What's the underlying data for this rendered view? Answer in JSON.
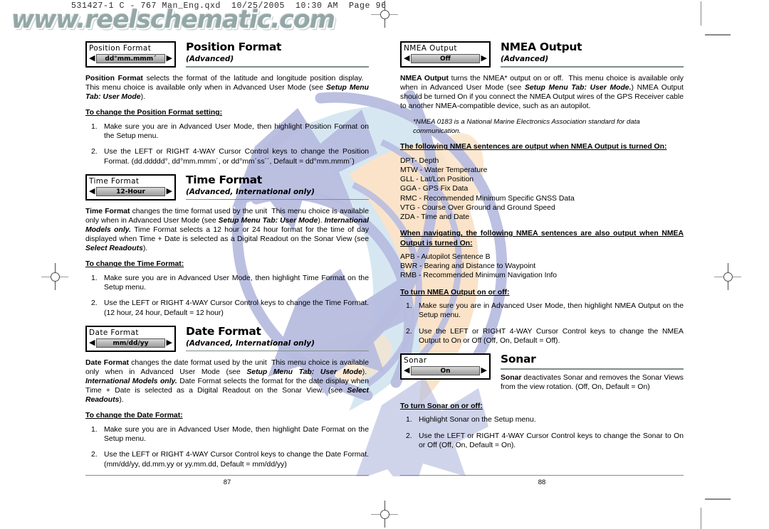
{
  "prepress": {
    "slug": "531427-1 C - 767 Man_Eng.qxd  10/25/2005  10:30 AM  Page 96",
    "watermark": "www.reelschematic.com"
  },
  "left_page": {
    "page_number": "87",
    "sections": [
      {
        "widget": {
          "label": "Position Format",
          "value": "dd°mm.mmm´",
          "left_arrow": "◀",
          "right_arrow": "▶"
        },
        "title": "Position Format",
        "subtitle": "(Advanced)",
        "intro_html": "<b>Position Format</b> selects the format of the latitude and longitude position display.&nbsp;&nbsp; This menu choice is available only when in Advanced User Mode (see <span class=\"bi\">Setup Menu Tab: User Mode</span>).",
        "sub_head": "To change the Position Format setting:",
        "steps": [
          "Make sure you are in Advanced User Mode, then highlight Position Format on the Setup menu.",
          "Use the LEFT or RIGHT 4-WAY Cursor Control keys to change the Position Format. (dd.ddddd°, dd°mm.mmm´, or dd°mm´ss´´, Default = dd°mm.mmm´)"
        ]
      },
      {
        "widget": {
          "label": "Time Format",
          "value": "12-Hour",
          "left_arrow": "◀",
          "right_arrow": "▶"
        },
        "title": "Time Format",
        "subtitle": "(Advanced, International only)",
        "intro_html": "<b>Time Format</b> changes the time format used by the unit&nbsp; This menu choice is available only when in Advanced User Mode (see <span class=\"bi\">Setup Menu Tab: User Mode</span>). <span class=\"bi\">International Models only.</span> Time Format selects a 12 hour or 24 hour format for the time of day displayed when Time + Date is selected as a Digital Readout on the Sonar View (see <span class=\"bi\">Select Readouts</span>).",
        "sub_head": "To change the Time Format:",
        "steps": [
          "Make sure you are in Advanced User Mode, then highlight Time Format on the Setup menu.",
          "Use the LEFT or RIGHT 4-WAY Cursor Control keys to change the Time Format. (12 hour, 24 hour, Default = 12 hour)"
        ]
      },
      {
        "widget": {
          "label": "Date Format",
          "value": "mm/dd/yy",
          "left_arrow": "◀",
          "right_arrow": "▶"
        },
        "title": "Date Format",
        "subtitle": "(Advanced, International only)",
        "intro_html": "<b>Date Format</b> changes the date format used by the unit&nbsp; This menu choice is available only when in Advanced User Mode (see <span class=\"bi\">Setup Menu Tab: User Mode</span>).&nbsp; <span class=\"bi\">International Models only.</span> Date Format selects the format for the date display when Time + Date is selected as a Digital Readout on the Sonar View. (see <span class=\"bi\">Select Readouts</span>).",
        "sub_head": "To change the Date Format:",
        "steps": [
          "Make sure you are in Advanced User Mode, then highlight Date Format on the Setup menu.",
          "Use the LEFT or RIGHT 4-WAY Cursor Control keys to change the Date Format. (mm/dd/yy, dd.mm.yy or yy.mm.dd, Default = mm/dd/yy)"
        ]
      }
    ]
  },
  "right_page": {
    "page_number": "88",
    "nmea": {
      "widget": {
        "label": "NMEA  Output",
        "value": "Off",
        "left_arrow": "◀",
        "right_arrow": "▶"
      },
      "title": "NMEA Output",
      "subtitle": "(Advanced)",
      "intro_html": "<b>NMEA Output</b> turns the NMEA* output on or off.&nbsp; This menu choice is available only when in Advanced User Mode (see <span class=\"bi\">Setup Menu Tab: User Mode.</span>) NMEA Output should be turned On if you connect the NMEA Output wires of the GPS Receiver cable to another NMEA-compatible device, such as an autopilot.",
      "footnote": "*NMEA 0183 is a National Marine Electronics Association standard for data communication.",
      "sentences_head": "The following NMEA sentences are output when NMEA Output is turned On:",
      "sentences": [
        "DPT- Depth",
        "MTW - Water Temperature",
        "GLL - Lat/Lon Position",
        "GGA - GPS Fix Data",
        "RMC - Recommended Minimum Specific GNSS Data",
        "VTG - Course Over Ground and Ground Speed",
        "ZDA - Time and Date"
      ],
      "nav_sentences_head": "When navigating, the following NMEA sentences are also output when NMEA Output is turned On:",
      "nav_sentences": [
        "APB - Autopilot Sentence B",
        "BWR - Bearing and Distance to Waypoint",
        "RMB - Recommended Minimum Navigation Info"
      ],
      "sub_head": "To turn NMEA Output on or off:",
      "steps": [
        "Make sure you are in Advanced User Mode, then highlight NMEA Output on the Setup menu.",
        "Use the LEFT or RIGHT 4-WAY Cursor Control keys to change the NMEA Output to On or Off (Off, On, Default = Off)."
      ]
    },
    "sonar": {
      "widget": {
        "label": "Sonar",
        "value": "On",
        "left_arrow": "◀",
        "right_arrow": "▶"
      },
      "title": "Sonar",
      "intro_html": "<b>Sonar</b> deactivates Sonar and removes the Sonar Views from the view rotation. (Off, On, Default = On)",
      "sub_head": "To turn Sonar on or off:",
      "steps": [
        "Highlight Sonar on the Setup menu.",
        "Use the LEFT or RIGHT 4-WAY Cursor Control keys to change the Sonar to On or Off (Off, On, Default = On)."
      ]
    }
  },
  "colors": {
    "rule": "#7d8f87",
    "watermark_art_blue": "#b8bde0",
    "watermark_art_peach": "#fadfc0",
    "watermark_art_lightblue": "#cfe3f0",
    "wordmark": "#8fa3a3"
  }
}
